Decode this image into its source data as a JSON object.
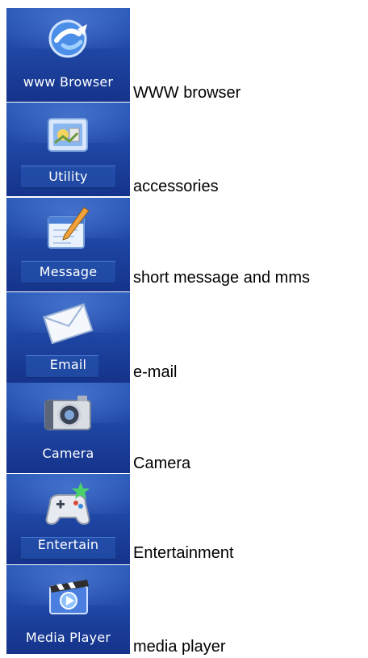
{
  "menu": {
    "items": [
      {
        "label": "www Browser",
        "caption": "WWW browser",
        "icon": "browser-globe-icon"
      },
      {
        "label": "Utility",
        "caption": "accessories",
        "icon": "utility-box-icon"
      },
      {
        "label": "Message",
        "caption": "short message and mms",
        "icon": "message-pencil-icon"
      },
      {
        "label": "Email",
        "caption": "e-mail",
        "icon": "envelope-icon"
      },
      {
        "label": "Camera",
        "caption": "Camera",
        "icon": "camera-icon"
      },
      {
        "label": "Entertain",
        "caption": "Entertainment",
        "icon": "gamepad-icon"
      },
      {
        "label": "Media Player",
        "caption": "media player",
        "icon": "film-clapper-icon"
      }
    ]
  }
}
